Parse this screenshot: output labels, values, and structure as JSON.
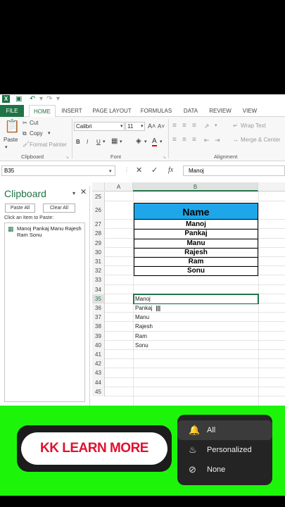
{
  "colors": {
    "excel_green": "#217346",
    "name_header_bg": "#1ea6e8",
    "banner_bg": "#1cf50a",
    "learn_text": "#e0102f"
  },
  "tabs": [
    "FILE",
    "HOME",
    "INSERT",
    "PAGE LAYOUT",
    "FORMULAS",
    "DATA",
    "REVIEW",
    "VIEW"
  ],
  "ribbon": {
    "paste": "Paste",
    "cut": "Cut",
    "copy": "Copy",
    "format_painter": "Format Painter",
    "font_name": "Calibri",
    "font_size": "11",
    "bold": "B",
    "italic": "I",
    "underline": "U",
    "wrap_text": "Wrap Text",
    "merge_center": "Merge & Center",
    "groups": {
      "clipboard": "Clipboard",
      "font": "Font",
      "alignment": "Alignment"
    }
  },
  "formula_bar": {
    "name_box": "B35",
    "fx": "fx",
    "content": "Manoj"
  },
  "clipboard_pane": {
    "title": "Clipboard",
    "paste_all": "Paste All",
    "clear_all": "Clear All",
    "hint": "Click an Item to Paste:",
    "item": "Manoj Pankaj Manu Rajesh Ram Sonu"
  },
  "grid": {
    "columns": [
      "A",
      "B"
    ],
    "rows": [
      "25",
      "26",
      "27",
      "28",
      "29",
      "30",
      "31",
      "32",
      "33",
      "34",
      "35",
      "36",
      "37",
      "38",
      "39",
      "40",
      "41",
      "42",
      "43",
      "44",
      "45"
    ],
    "table_header": "Name",
    "table_values": [
      "Manoj",
      "Pankaj",
      "Manu",
      "Rajesh",
      "Ram",
      "Sonu"
    ],
    "pasted_values": [
      "Manoj",
      "Pankaj",
      "Manu",
      "Rajesh",
      "Ram",
      "Sonu"
    ],
    "selected_row": "35"
  },
  "banner": {
    "button_text": "KK LEARN MORE",
    "bell_options": [
      "All",
      "Personalized",
      "None"
    ],
    "selected_option": "All"
  }
}
